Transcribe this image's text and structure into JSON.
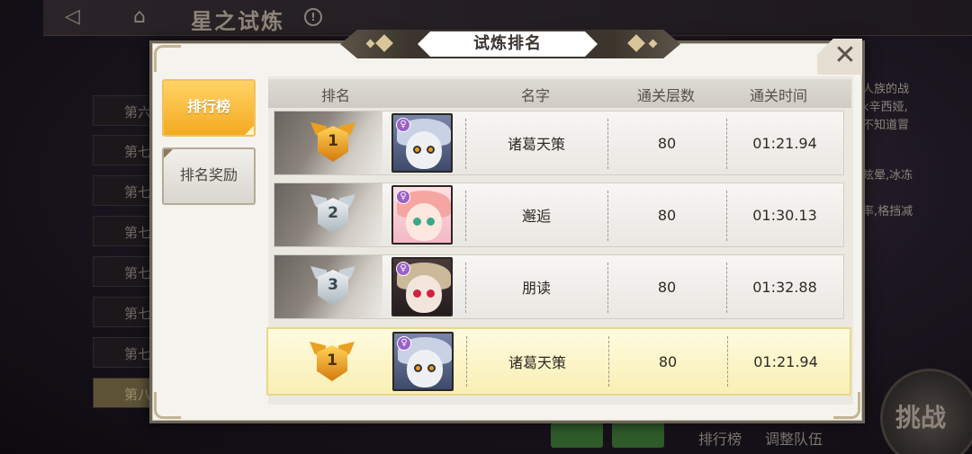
{
  "background": {
    "title": "星之试炼",
    "left_list": [
      "第六",
      "第七",
      "第七",
      "第七",
      "第七",
      "第七",
      "第七",
      "第八"
    ],
    "desc_lines": [
      "人族的战",
      "k辛西娅,",
      "不知道冒",
      "眩晕,冰冻",
      "率,格挡减"
    ],
    "challenge_button": "挑战",
    "bottom_buttons": [
      "排行榜",
      "调整队伍"
    ]
  },
  "modal": {
    "title": "试炼排名",
    "tabs": [
      {
        "label": "排行榜",
        "active": true
      },
      {
        "label": "排名奖励",
        "active": false
      }
    ],
    "headers": {
      "rank": "排名",
      "name": "名字",
      "floors": "通关层数",
      "time": "通关时间"
    },
    "rows": [
      {
        "rank": "1",
        "medal": "gold",
        "avatar": "blue-hat-goggles-girl",
        "name": "诸葛天策",
        "floors": "80",
        "time": "01:21.94"
      },
      {
        "rank": "2",
        "medal": "silver",
        "avatar": "pink-hair-flower-girl",
        "name": "邂逅",
        "floors": "80",
        "time": "01:30.13"
      },
      {
        "rank": "3",
        "medal": "silver",
        "avatar": "witch-hat-red-eye-girl",
        "name": "朋读",
        "floors": "80",
        "time": "01:32.88"
      }
    ],
    "my_row": {
      "rank": "1",
      "medal": "gold",
      "avatar": "blue-hat-goggles-girl",
      "name": "诸葛天策",
      "floors": "80",
      "time": "01:21.94"
    }
  },
  "icons": {
    "back": "back-icon",
    "home": "home-icon",
    "help": "help-icon",
    "close": "close-icon",
    "avatar_badge": "female-symbol-icon"
  },
  "colors": {
    "accent_gold": "#f4aa21",
    "highlight_row": "#f9efb3",
    "frame": "#6b6358"
  }
}
